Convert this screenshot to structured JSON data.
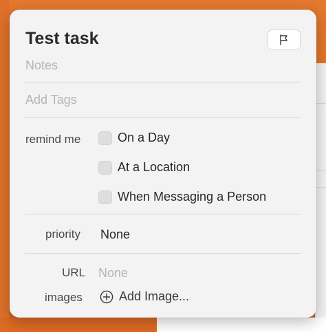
{
  "task": {
    "title": "Test task",
    "notes_placeholder": "Notes",
    "tags_placeholder": "Add Tags"
  },
  "remind_me": {
    "label": "remind me",
    "options": [
      {
        "label": "On a Day",
        "checked": false
      },
      {
        "label": "At a Location",
        "checked": false
      },
      {
        "label": "When Messaging a Person",
        "checked": false
      }
    ]
  },
  "priority": {
    "label": "priority",
    "value": "None"
  },
  "url": {
    "label": "URL",
    "placeholder": "None"
  },
  "images": {
    "label": "images",
    "add_label": "Add Image..."
  },
  "icons": {
    "flag": "flag-icon",
    "add": "plus-circle-icon"
  },
  "colors": {
    "background_accent": "#dd6b24",
    "popover": "#f3f3f3"
  }
}
